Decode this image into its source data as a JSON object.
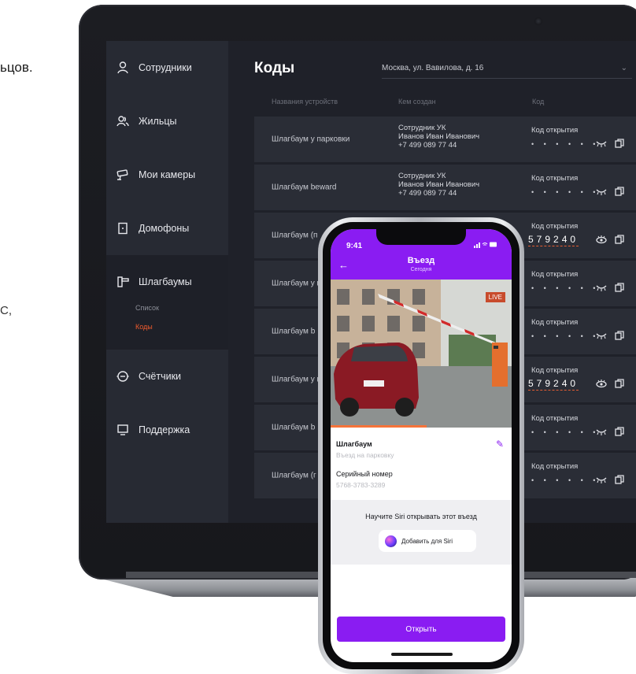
{
  "page_fragments": {
    "frag1": "ьцов.",
    "frag2": "С,"
  },
  "sidebar": {
    "items": [
      {
        "label": "Сотрудники",
        "icon": "person-icon"
      },
      {
        "label": "Жильцы",
        "icon": "people-icon"
      },
      {
        "label": "Мои камеры",
        "icon": "camera-icon"
      },
      {
        "label": "Домофоны",
        "icon": "intercom-icon"
      },
      {
        "label": "Шлагбаумы",
        "icon": "barrier-icon",
        "sub": [
          "Список",
          "Коды"
        ],
        "active_sub": "Коды"
      },
      {
        "label": "Счётчики",
        "icon": "meter-icon"
      },
      {
        "label": "Поддержка",
        "icon": "support-icon"
      }
    ]
  },
  "main": {
    "title": "Коды",
    "address": "Москва, ул. Вавилова, д. 16",
    "columns": [
      "Названия устройств",
      "Кем создан",
      "Код"
    ],
    "rows": [
      {
        "device": "Шлагбаум у парковки",
        "by1": "Сотрудник УК",
        "by2": "Иванов Иван Иванович",
        "by3": "+7 499 089 77 44",
        "code_label": "Код открытия",
        "code": "• • • • • •"
      },
      {
        "device": "Шлагбаум beward",
        "by1": "Сотрудник УК",
        "by2": "Иванов Иван Иванович",
        "by3": "+7 499 089 77 44",
        "code_label": "Код открытия",
        "code": "• • • • • •"
      },
      {
        "device": "Шлагбаум (п",
        "code_label": "Код открытия",
        "code": "579240",
        "visible": true
      },
      {
        "device": "Шлагбаум у въезда",
        "code_label": "Код открытия",
        "code": "• • • • • •"
      },
      {
        "device": "Шлагбаум b",
        "code_label": "Код открытия",
        "code": "• • • • • •"
      },
      {
        "device": "Шлагбаум у въезда",
        "code_label": "Код открытия",
        "code": "579240",
        "visible": true
      },
      {
        "device": "Шлагбаум b",
        "code_label": "Код открытия",
        "code": "• • • • • •"
      },
      {
        "device": "Шлагбаум (г",
        "code_label": "Код открытия",
        "code": "• • • • • •"
      }
    ]
  },
  "phone": {
    "time": "9:41",
    "title": "Въезд",
    "subtitle": "Сегодня",
    "live": "LIVE",
    "barrier_label": "Шлагбаум",
    "barrier_value": "Въезд на парковку",
    "serial_label": "Серийный номер",
    "serial_value": "5768-3783-3289",
    "siri_title": "Научите Siri открывать этот въезд",
    "siri_button": "Добавить для Siri",
    "open_button": "Открыть",
    "progress": 0.53
  },
  "colors": {
    "accent": "#8a1cf2",
    "highlight": "#ee5a2d",
    "sidebar": "#272a33",
    "table_row": "#2a2d36"
  }
}
